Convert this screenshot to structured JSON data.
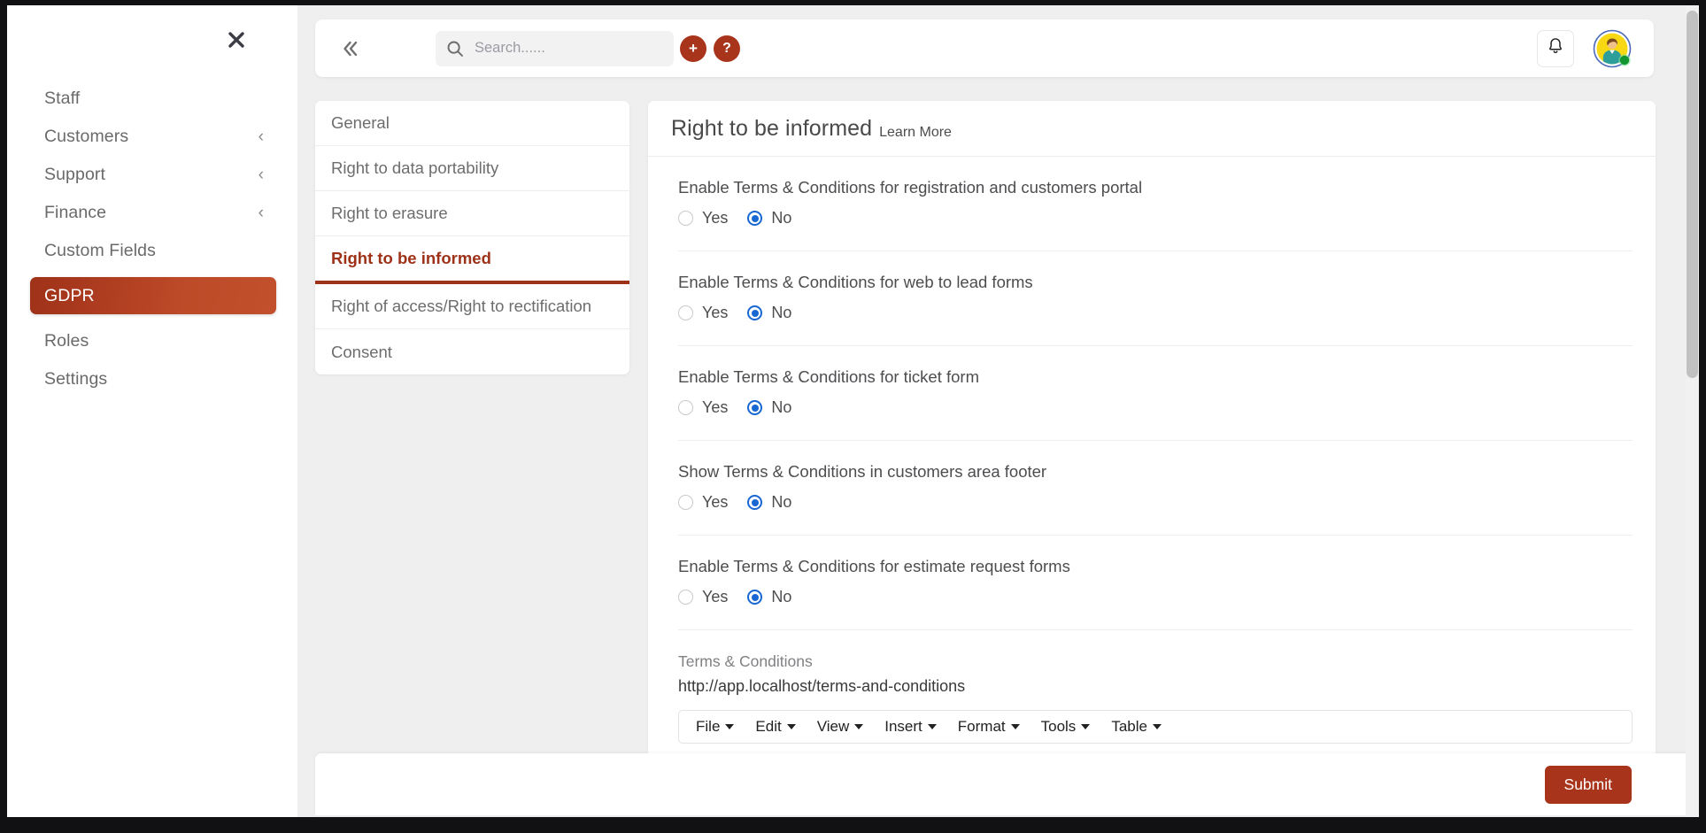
{
  "sidebar": {
    "close_icon": "close-icon",
    "items": [
      {
        "label": "Staff",
        "chevron": "",
        "active": false
      },
      {
        "label": "Customers",
        "chevron": "‹",
        "active": false
      },
      {
        "label": "Support",
        "chevron": "‹",
        "active": false
      },
      {
        "label": "Finance",
        "chevron": "‹",
        "active": false
      },
      {
        "label": "Custom Fields",
        "chevron": "",
        "active": false
      },
      {
        "label": "GDPR",
        "chevron": "",
        "active": true
      },
      {
        "label": "Roles",
        "chevron": "",
        "active": false
      },
      {
        "label": "Settings",
        "chevron": "",
        "active": false
      }
    ]
  },
  "topbar": {
    "collapse_icon": "double-chevron-left-icon",
    "search": {
      "icon": "search-icon",
      "value": "",
      "placeholder": "Search......"
    },
    "add_label": "+",
    "help_label": "?",
    "bell_icon": "bell-icon",
    "avatar_icon": "user-avatar",
    "avatar_status": "online"
  },
  "tabs": [
    {
      "label": "General",
      "active": false
    },
    {
      "label": "Right to data portability",
      "active": false
    },
    {
      "label": "Right to erasure",
      "active": false
    },
    {
      "label": "Right to be informed",
      "active": true
    },
    {
      "label": "Right of access/Right to rectification",
      "active": false
    },
    {
      "label": "Consent",
      "active": false
    }
  ],
  "panel": {
    "title": "Right to be informed",
    "learn_more": "Learn More",
    "fields": [
      {
        "label": "Enable Terms & Conditions for registration and customers portal",
        "options": [
          {
            "label": "Yes",
            "checked": false
          },
          {
            "label": "No",
            "checked": true
          }
        ]
      },
      {
        "label": "Enable Terms & Conditions for web to lead forms",
        "options": [
          {
            "label": "Yes",
            "checked": false
          },
          {
            "label": "No",
            "checked": true
          }
        ]
      },
      {
        "label": "Enable Terms & Conditions for ticket form",
        "options": [
          {
            "label": "Yes",
            "checked": false
          },
          {
            "label": "No",
            "checked": true
          }
        ]
      },
      {
        "label": "Show Terms & Conditions in customers area footer",
        "options": [
          {
            "label": "Yes",
            "checked": false
          },
          {
            "label": "No",
            "checked": true
          }
        ]
      },
      {
        "label": "Enable Terms & Conditions for estimate request forms",
        "options": [
          {
            "label": "Yes",
            "checked": false
          },
          {
            "label": "No",
            "checked": true
          }
        ]
      }
    ],
    "terms": {
      "label": "Terms & Conditions",
      "url": "http://app.localhost/terms-and-conditions"
    },
    "editor_menus": [
      "File",
      "Edit",
      "View",
      "Insert",
      "Format",
      "Tools",
      "Table"
    ]
  },
  "bottombar": {
    "submit_label": "Submit"
  },
  "colors": {
    "brand": "#a9341c",
    "brand_dark": "#9e3219",
    "brand_light": "#c2502c",
    "radio_blue": "#1967d2",
    "page_bg": "#efefef",
    "card_bg": "#ffffff",
    "text": "#4d4d50",
    "muted": "#818184"
  }
}
